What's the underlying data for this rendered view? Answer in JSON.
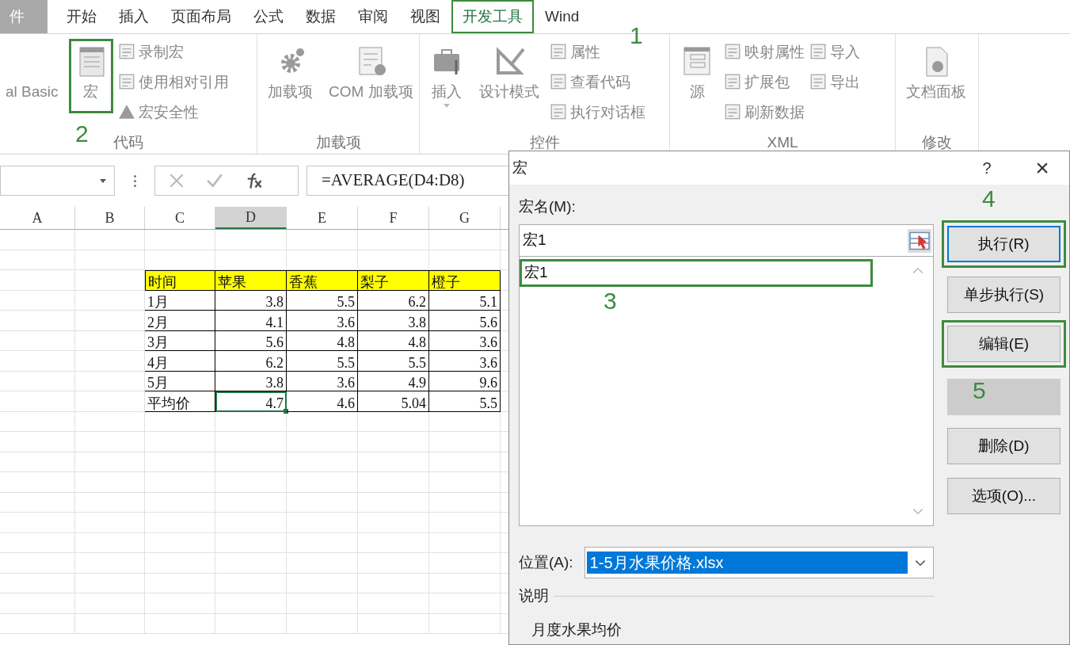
{
  "tabs": [
    {
      "label": "件",
      "selected": false,
      "framed": false,
      "kind": "file"
    },
    {
      "label": "开始",
      "selected": false,
      "framed": false,
      "kind": "tab"
    },
    {
      "label": "插入",
      "selected": false,
      "framed": false,
      "kind": "tab"
    },
    {
      "label": "页面布局",
      "selected": false,
      "framed": false,
      "kind": "tab"
    },
    {
      "label": "公式",
      "selected": false,
      "framed": false,
      "kind": "tab"
    },
    {
      "label": "数据",
      "selected": false,
      "framed": false,
      "kind": "tab"
    },
    {
      "label": "审阅",
      "selected": false,
      "framed": false,
      "kind": "tab"
    },
    {
      "label": "视图",
      "selected": false,
      "framed": false,
      "kind": "tab"
    },
    {
      "label": "开发工具",
      "selected": true,
      "framed": true,
      "kind": "tab"
    },
    {
      "label": "Wind",
      "selected": false,
      "framed": false,
      "kind": "tab"
    }
  ],
  "ribbon": {
    "groups": [
      {
        "label": "代码",
        "big": [
          {
            "label": "al Basic",
            "framed": false,
            "has_menu": false
          },
          {
            "label": "宏",
            "framed": true,
            "has_menu": false
          }
        ],
        "small": [
          [
            "录制宏",
            "使用相对引用",
            "宏安全性"
          ]
        ]
      },
      {
        "label": "加载项",
        "big": [
          {
            "label": "加载项",
            "framed": false,
            "has_menu": false
          },
          {
            "label": "COM 加载项",
            "framed": false,
            "has_menu": false
          }
        ]
      },
      {
        "label": "控件",
        "big": [
          {
            "label": "插入",
            "framed": false,
            "has_menu": true
          },
          {
            "label": "设计模式",
            "framed": false,
            "has_menu": false
          }
        ],
        "small": [
          [
            "属性",
            "查看代码",
            "执行对话框"
          ]
        ]
      },
      {
        "label": "XML",
        "big": [
          {
            "label": "源",
            "framed": false,
            "has_menu": false
          }
        ],
        "small": [
          [
            "映射属性",
            "扩展包",
            "刷新数据"
          ],
          [
            "导入",
            "导出"
          ]
        ]
      },
      {
        "label": "修改",
        "big": [
          {
            "label": "文档面板",
            "framed": false,
            "has_menu": false
          }
        ]
      }
    ]
  },
  "formula_bar": {
    "formula": "=AVERAGE(D4:D8)"
  },
  "sheet": {
    "columns": [
      {
        "label": "A",
        "selected": false
      },
      {
        "label": "B",
        "selected": false
      },
      {
        "label": "C",
        "selected": false
      },
      {
        "label": "D",
        "selected": true
      },
      {
        "label": "E",
        "selected": false
      },
      {
        "label": "F",
        "selected": false
      },
      {
        "label": "G",
        "selected": false
      }
    ],
    "table": {
      "header": [
        "时间",
        "苹果",
        "香蕉",
        "梨子",
        "橙子"
      ],
      "rows": [
        {
          "cells": [
            {
              "text": "1月",
              "selected": false
            },
            {
              "text": "3.8",
              "selected": false
            },
            {
              "text": "5.5",
              "selected": false
            },
            {
              "text": "6.2",
              "selected": false
            },
            {
              "text": "5.1",
              "selected": false
            }
          ]
        },
        {
          "cells": [
            {
              "text": "2月",
              "selected": false
            },
            {
              "text": "4.1",
              "selected": false
            },
            {
              "text": "3.6",
              "selected": false
            },
            {
              "text": "3.8",
              "selected": false
            },
            {
              "text": "5.6",
              "selected": false
            }
          ]
        },
        {
          "cells": [
            {
              "text": "3月",
              "selected": false
            },
            {
              "text": "5.6",
              "selected": false
            },
            {
              "text": "4.8",
              "selected": false
            },
            {
              "text": "4.8",
              "selected": false
            },
            {
              "text": "3.6",
              "selected": false
            }
          ]
        },
        {
          "cells": [
            {
              "text": "4月",
              "selected": false
            },
            {
              "text": "6.2",
              "selected": false
            },
            {
              "text": "5.5",
              "selected": false
            },
            {
              "text": "5.5",
              "selected": false
            },
            {
              "text": "3.6",
              "selected": false
            }
          ]
        },
        {
          "cells": [
            {
              "text": "5月",
              "selected": false
            },
            {
              "text": "3.8",
              "selected": false
            },
            {
              "text": "3.6",
              "selected": false
            },
            {
              "text": "4.9",
              "selected": false
            },
            {
              "text": "9.6",
              "selected": false
            }
          ]
        },
        {
          "cells": [
            {
              "text": "平均价",
              "selected": false
            },
            {
              "text": "4.7",
              "selected": true
            },
            {
              "text": "4.6",
              "selected": false
            },
            {
              "text": "5.04",
              "selected": false
            },
            {
              "text": "5.5",
              "selected": false
            }
          ]
        }
      ]
    }
  },
  "dialog": {
    "title": "宏",
    "help": "?",
    "close": "×",
    "name_label": "宏名(M):",
    "name_value": "宏1",
    "macros": [
      {
        "label": "宏1",
        "selected": false,
        "framed": true
      }
    ],
    "buttons": [
      {
        "label": "执行(R)",
        "focused": true,
        "disabled": false,
        "framed": true
      },
      {
        "label": "单步执行(S)",
        "focused": false,
        "disabled": false,
        "framed": false
      },
      {
        "label": "编辑(E)",
        "focused": false,
        "disabled": false,
        "framed": true
      },
      {
        "focused": false,
        "disabled": true,
        "framed": false
      },
      {
        "label": "删除(D)",
        "focused": false,
        "disabled": false,
        "framed": false
      },
      {
        "label": "选项(O)...",
        "focused": false,
        "disabled": false,
        "framed": false
      }
    ],
    "location_label": "位置(A):",
    "location_value": "1-5月水果价格.xlsx",
    "description_label": "说明",
    "description": "月度水果均价"
  },
  "annotations": [
    "1",
    "2",
    "3",
    "4",
    "5"
  ]
}
